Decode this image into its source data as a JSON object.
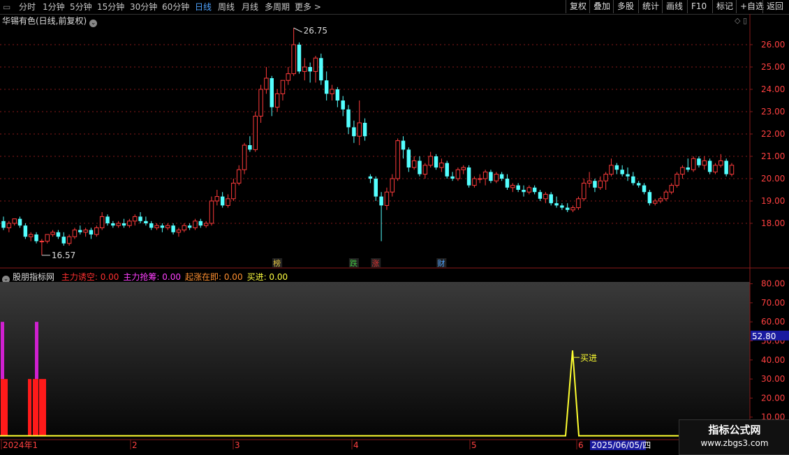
{
  "toolbar": {
    "periods": [
      "分时",
      "1分钟",
      "5分钟",
      "15分钟",
      "30分钟",
      "60分钟",
      "日线",
      "周线",
      "月线",
      "多周期",
      "更多 >"
    ],
    "active": "日线",
    "right_buttons": [
      "复权",
      "叠加",
      "多股",
      "统计",
      "画线",
      "F10",
      "标记",
      "+自选",
      "返回"
    ]
  },
  "stock": {
    "title": "华锡有色(日线,前复权)"
  },
  "price_axis": [
    "26.00",
    "25.00",
    "24.00",
    "23.00",
    "22.00",
    "21.00",
    "20.00",
    "19.00",
    "18.00"
  ],
  "annotations": {
    "high": "26.75",
    "low": "16.57",
    "buy_label": "买进"
  },
  "event_markers": [
    {
      "text": "榜",
      "color": "#e0c040"
    },
    {
      "text": "跌",
      "color": "#40c040"
    },
    {
      "text": "涨",
      "color": "#e03030"
    },
    {
      "text": "财",
      "color": "#4fa3ff"
    }
  ],
  "indicator": {
    "name": "股朋指标网",
    "items": [
      {
        "label": "主力诱空:",
        "value": "0.00",
        "color": "#ff3030"
      },
      {
        "label": "主力抢筹:",
        "value": "0.00",
        "color": "#ff40ff"
      },
      {
        "label": "起涨在即:",
        "value": "0.00",
        "color": "#ff9030"
      },
      {
        "label": "买进:",
        "value": "0.00",
        "color": "#ffff40"
      }
    ],
    "axis": [
      "80.00",
      "70.00",
      "60.00",
      "50.00",
      "40.00",
      "30.00",
      "20.00",
      "10.00"
    ],
    "cursor_value": "52.80"
  },
  "time_axis": {
    "labels": [
      "2024年1",
      "2",
      "3",
      "4",
      "5",
      "6"
    ],
    "cursor_date": "2025/06/05/四"
  },
  "watermark": {
    "line1": "指标公式网",
    "line2": "www.zbgs3.com"
  },
  "colors": {
    "up": "#ff3b3b",
    "down": "#54ffff",
    "grid": "#8a1a1a"
  },
  "chart_data": {
    "type": "candlestick",
    "ohlc": [
      [
        18.1,
        18.3,
        17.7,
        17.8
      ],
      [
        17.8,
        18.1,
        17.6,
        18.0
      ],
      [
        18.0,
        18.2,
        17.9,
        18.2
      ],
      [
        18.2,
        18.3,
        17.8,
        17.9
      ],
      [
        17.9,
        18.0,
        17.3,
        17.4
      ],
      [
        17.4,
        17.6,
        17.2,
        17.5
      ],
      [
        17.5,
        17.6,
        17.1,
        17.2
      ],
      [
        17.2,
        17.3,
        16.57,
        17.2
      ],
      [
        17.2,
        17.5,
        17.1,
        17.5
      ],
      [
        17.5,
        17.7,
        17.4,
        17.6
      ],
      [
        17.6,
        17.7,
        17.3,
        17.4
      ],
      [
        17.4,
        17.6,
        17.0,
        17.1
      ],
      [
        17.1,
        17.5,
        17.0,
        17.4
      ],
      [
        17.4,
        17.8,
        17.3,
        17.7
      ],
      [
        17.7,
        17.9,
        17.5,
        17.6
      ],
      [
        17.6,
        17.8,
        17.4,
        17.7
      ],
      [
        17.7,
        17.8,
        17.3,
        17.5
      ],
      [
        17.5,
        17.9,
        17.4,
        17.8
      ],
      [
        17.8,
        18.5,
        17.7,
        18.3
      ],
      [
        18.3,
        18.4,
        17.9,
        18.0
      ],
      [
        18.0,
        18.1,
        17.8,
        17.9
      ],
      [
        17.9,
        18.1,
        17.8,
        18.0
      ],
      [
        18.0,
        18.2,
        17.8,
        17.9
      ],
      [
        17.9,
        18.2,
        17.8,
        18.1
      ],
      [
        18.1,
        18.4,
        17.9,
        18.3
      ],
      [
        18.3,
        18.5,
        18.0,
        18.1
      ],
      [
        18.1,
        18.3,
        17.9,
        18.0
      ],
      [
        18.0,
        18.1,
        17.7,
        17.8
      ],
      [
        17.8,
        18.0,
        17.7,
        17.9
      ],
      [
        17.9,
        18.0,
        17.6,
        17.8
      ],
      [
        17.8,
        18.0,
        17.7,
        17.9
      ],
      [
        17.9,
        18.0,
        17.5,
        17.6
      ],
      [
        17.6,
        17.8,
        17.4,
        17.7
      ],
      [
        17.7,
        18.0,
        17.6,
        17.9
      ],
      [
        17.9,
        18.0,
        17.7,
        17.8
      ],
      [
        17.8,
        18.2,
        17.7,
        18.1
      ],
      [
        18.1,
        18.2,
        17.8,
        17.9
      ],
      [
        17.9,
        18.1,
        17.8,
        18.0
      ],
      [
        18.0,
        19.2,
        17.9,
        19.0
      ],
      [
        19.0,
        19.5,
        18.8,
        19.2
      ],
      [
        19.2,
        19.4,
        18.7,
        18.8
      ],
      [
        18.8,
        19.3,
        18.7,
        19.1
      ],
      [
        19.1,
        20.0,
        19.0,
        19.8
      ],
      [
        19.8,
        20.6,
        19.7,
        20.4
      ],
      [
        20.4,
        21.6,
        20.2,
        21.5
      ],
      [
        21.5,
        21.9,
        21.2,
        21.3
      ],
      [
        21.3,
        23.0,
        21.2,
        22.8
      ],
      [
        22.8,
        24.2,
        22.5,
        24.0
      ],
      [
        24.0,
        25.0,
        23.8,
        24.5
      ],
      [
        24.5,
        24.6,
        22.8,
        23.2
      ],
      [
        23.2,
        24.0,
        23.0,
        23.8
      ],
      [
        23.8,
        24.4,
        23.5,
        24.4
      ],
      [
        24.4,
        25.0,
        24.2,
        24.7
      ],
      [
        24.7,
        26.75,
        24.6,
        26.0
      ],
      [
        26.0,
        26.1,
        24.7,
        24.8
      ],
      [
        24.8,
        25.4,
        24.4,
        25.0
      ],
      [
        25.0,
        25.2,
        24.3,
        24.8
      ],
      [
        24.8,
        25.5,
        24.3,
        25.4
      ],
      [
        25.4,
        25.6,
        24.2,
        24.4
      ],
      [
        24.4,
        24.8,
        23.5,
        23.8
      ],
      [
        23.8,
        24.2,
        23.5,
        24.0
      ],
      [
        24.0,
        24.1,
        23.2,
        23.5
      ],
      [
        23.5,
        23.7,
        22.8,
        23.1
      ],
      [
        23.1,
        23.3,
        22.0,
        22.3
      ],
      [
        22.3,
        22.6,
        21.6,
        21.9
      ],
      [
        21.9,
        23.5,
        21.5,
        22.5
      ],
      [
        22.5,
        22.7,
        21.7,
        21.9
      ],
      [
        20.1,
        20.2,
        19.8,
        20.0
      ],
      [
        20.0,
        20.1,
        19.0,
        19.2
      ],
      [
        19.2,
        19.4,
        17.2,
        18.8
      ],
      [
        18.8,
        19.6,
        18.6,
        19.4
      ],
      [
        19.4,
        20.2,
        19.2,
        20.0
      ],
      [
        20.0,
        21.8,
        19.9,
        21.7
      ],
      [
        21.7,
        21.9,
        20.9,
        21.3
      ],
      [
        21.3,
        21.4,
        20.3,
        20.5
      ],
      [
        20.5,
        21.0,
        20.4,
        20.8
      ],
      [
        20.8,
        21.0,
        20.1,
        20.2
      ],
      [
        20.2,
        20.7,
        20.0,
        20.6
      ],
      [
        20.6,
        21.2,
        20.5,
        21.0
      ],
      [
        21.0,
        21.1,
        20.4,
        20.5
      ],
      [
        20.5,
        20.9,
        20.3,
        20.7
      ],
      [
        20.7,
        20.8,
        20.0,
        20.1
      ],
      [
        20.1,
        20.3,
        19.9,
        20.0
      ],
      [
        20.0,
        20.5,
        19.9,
        20.4
      ],
      [
        20.4,
        20.6,
        20.2,
        20.5
      ],
      [
        20.5,
        20.6,
        19.6,
        19.7
      ],
      [
        19.7,
        20.1,
        19.6,
        20.0
      ],
      [
        20.0,
        20.2,
        19.8,
        20.0
      ],
      [
        20.0,
        20.4,
        19.7,
        20.3
      ],
      [
        20.3,
        20.4,
        19.8,
        19.9
      ],
      [
        19.9,
        20.3,
        19.8,
        20.2
      ],
      [
        20.2,
        20.3,
        19.9,
        20.0
      ],
      [
        20.0,
        20.2,
        19.5,
        19.6
      ],
      [
        19.6,
        19.8,
        19.4,
        19.7
      ],
      [
        19.7,
        19.8,
        19.4,
        19.5
      ],
      [
        19.5,
        19.7,
        19.2,
        19.4
      ],
      [
        19.4,
        19.7,
        19.3,
        19.6
      ],
      [
        19.6,
        19.7,
        19.3,
        19.4
      ],
      [
        19.4,
        19.5,
        19.0,
        19.1
      ],
      [
        19.1,
        19.4,
        18.9,
        19.3
      ],
      [
        19.3,
        19.4,
        18.8,
        18.9
      ],
      [
        18.9,
        19.2,
        18.7,
        18.8
      ],
      [
        18.8,
        18.9,
        18.6,
        18.7
      ],
      [
        18.7,
        18.9,
        18.5,
        18.6
      ],
      [
        18.6,
        18.8,
        18.5,
        18.7
      ],
      [
        18.7,
        19.2,
        18.6,
        19.1
      ],
      [
        19.1,
        20.0,
        19.0,
        19.8
      ],
      [
        19.8,
        20.3,
        19.6,
        19.9
      ],
      [
        19.9,
        20.0,
        19.4,
        19.6
      ],
      [
        19.6,
        20.1,
        19.5,
        19.9
      ],
      [
        19.9,
        20.3,
        19.5,
        20.2
      ],
      [
        20.2,
        20.9,
        20.1,
        20.6
      ],
      [
        20.6,
        20.7,
        20.2,
        20.4
      ],
      [
        20.4,
        20.6,
        20.1,
        20.2
      ],
      [
        20.2,
        20.5,
        19.9,
        20.1
      ],
      [
        20.1,
        20.3,
        19.7,
        19.8
      ],
      [
        19.8,
        19.9,
        19.6,
        19.7
      ],
      [
        19.7,
        19.8,
        19.3,
        19.4
      ],
      [
        19.4,
        19.5,
        18.8,
        18.9
      ],
      [
        18.9,
        19.1,
        18.8,
        19.0
      ],
      [
        19.0,
        19.2,
        18.9,
        19.1
      ],
      [
        19.1,
        19.5,
        19.0,
        19.4
      ],
      [
        19.4,
        19.8,
        19.3,
        19.7
      ],
      [
        19.7,
        20.3,
        19.6,
        20.2
      ],
      [
        20.2,
        20.6,
        20.0,
        20.5
      ],
      [
        20.5,
        20.9,
        20.3,
        20.4
      ],
      [
        20.4,
        21.0,
        20.3,
        20.9
      ],
      [
        20.9,
        21.0,
        20.5,
        20.6
      ],
      [
        20.6,
        21.0,
        20.4,
        20.8
      ],
      [
        20.8,
        20.9,
        20.2,
        20.3
      ],
      [
        20.3,
        20.7,
        20.2,
        20.6
      ],
      [
        20.6,
        21.1,
        20.5,
        20.8
      ],
      [
        20.8,
        20.9,
        20.1,
        20.2
      ],
      [
        20.2,
        20.7,
        20.1,
        20.6
      ]
    ],
    "indicator_bars": [
      {
        "x": 1,
        "red": 30,
        "magenta": 60
      },
      {
        "x": 6,
        "red": 30,
        "magenta": 0
      },
      {
        "x": 40,
        "red": 30,
        "magenta": 0
      },
      {
        "x": 47,
        "red": 30,
        "magenta": 0
      },
      {
        "x": 50,
        "red": 30,
        "magenta": 60
      },
      {
        "x": 56,
        "red": 30,
        "magenta": 0
      },
      {
        "x": 61,
        "red": 30,
        "magenta": 0
      }
    ],
    "buy_signal": {
      "date": "2025/06/05",
      "peak": 45
    },
    "y_range_price": [
      17.2,
      26.75
    ],
    "y_range_indicator": [
      0,
      85
    ]
  }
}
